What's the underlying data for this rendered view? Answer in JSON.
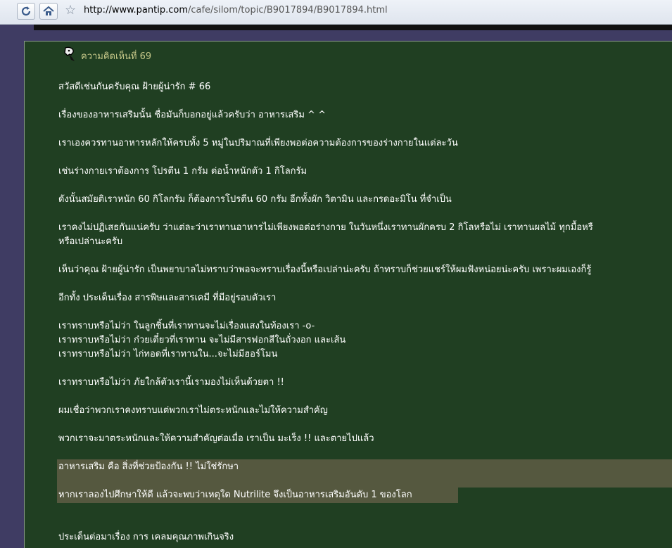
{
  "browser": {
    "url_host": "http://www.pantip.com",
    "url_path": "/cafe/silom/topic/B9017894/B9017894.html"
  },
  "comment": {
    "title": "ความคิดเห็นที่ 69",
    "lines": [
      "สวัสดีเช่นกันครับคุณ ฝ้ายผู้น่ารัก # 66",
      "เรื่องของอาหารเสริมนั้น ชื่อมันก็บอกอยู่แล้วครับว่า อาหารเสริม ^ ^",
      "เราเองควรทานอาหารหลักให้ครบทั้ง 5 หมู่ในปริมาณที่เพียงพอต่อความต้องการของร่างกายในแต่ละวัน",
      "เช่นร่างกายเราต้องการ โปรตีน 1 กรัม ต่อน้ำหนักตัว 1 กิโลกรัม",
      "ดังนั้นสมัยติเราหนัก 60 กิโลกรัม ก็ต้องการโปรตีน 60 กรัม อีกทั้งผัก วิตามิน และกรดอะมิโน ที่จำเป็น",
      "เราคงไม่ปฏิเสธกันแน่ครับ ว่าแต่ละว่าเราทานอาหารไม่เพียงพอต่อร่างกาย ในวันหนึ่งเราทานผักครบ 2 กิโลหรือไม่ เราทานผลไม้ ทุกมื้อหรื",
      "หรือเปล่านะครับ",
      "เห็นว่าคุณ ฝ้ายผู้น่ารัก เป็นพยาบาลไม่ทราบว่าพอจะทราบเรื่องนี้หรือเปล่าน่ะครับ ถ้าทราบก็ช่วยแชร์ให้ผมฟังหน่อยน่ะครับ เพราะผมเองก็รู้",
      "อีกทั้ง ประเด็นเรื่อง สารพิษและสารเคมี ที่มีอยู่รอบตัวเรา",
      "เราทราบหรือไม่ว่า ในลูกชิ้นที่เราทานจะไม่เรื่องแสงในท้องเรา -o-",
      "เราทราบหรือไม่ว่า ก๋วยเตี๋ยวที่เราทาน จะไม่มีสารฟอกสีในถั่วงอก และเส้น",
      "เราทราบหรือไม่ว่า ไก่ทอดที่เราทานใน...จะไม่มีฮอร์โมน",
      "เราทราบหรือไม่ว่า ภัยใกล้ตัวเรานี้เรามองไม่เห็นด้วยตา !!",
      "ผมเชื่อว่าพวกเราคงทราบแต่พวกเราไม่ตระหนักและไม่ให้ความสำคัญ",
      "พวกเราจะมาตระหนักและให้ความสำคัญต่อเมื่อ เราเป็น มะเร็ง !! และตายไปแล้ว",
      "อาหารเสริม คือ สิ่งที่ช่วยป้องกัน !! ไม่ใช่รักษา",
      "หากเราลองไปศึกษาให้ดี แล้วจะพบว่าเหตุใด Nutrilite จึงเป็นอาหารเสริมอันดับ 1 ของโลก",
      "ประเด็นต่อมาเรื่อง การ เคลมคุณภาพเกินจริง"
    ]
  }
}
